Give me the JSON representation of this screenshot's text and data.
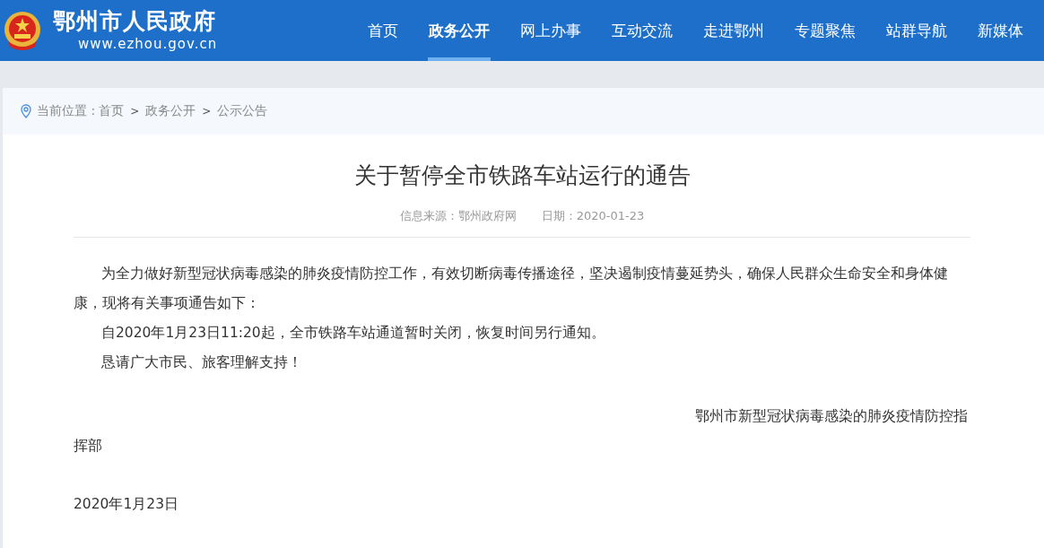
{
  "site": {
    "name": "鄂州市人民政府",
    "url": "www.ezhou.gov.cn"
  },
  "nav": [
    {
      "label": "首页",
      "selected": false
    },
    {
      "label": "政务公开",
      "selected": true
    },
    {
      "label": "网上办事",
      "selected": false
    },
    {
      "label": "互动交流",
      "selected": false
    },
    {
      "label": "走进鄂州",
      "selected": false
    },
    {
      "label": "专题聚焦",
      "selected": false
    },
    {
      "label": "站群导航",
      "selected": false
    },
    {
      "label": "新媒体",
      "selected": false
    }
  ],
  "breadcrumb": {
    "prefix": "当前位置 :",
    "items": [
      "首页",
      "政务公开",
      "公示公告"
    ],
    "separator": ">"
  },
  "article": {
    "title": "关于暂停全市铁路车站运行的通告",
    "source": "信息来源：鄂州政府网",
    "date": "日期：2020-01-23",
    "paragraphs": [
      "为全力做好新型冠状病毒感染的肺炎疫情防控工作，有效切断病毒传播途径，坚决遏制疫情蔓延势头，确保人民群众生命安全和身体健康，现将有关事项通告如下：",
      "自2020年1月23日11:20起，全市铁路车站通道暂时关闭，恢复时间另行通知。",
      "恳请广大市民、旅客理解支持！"
    ],
    "signature": "鄂州市新型冠状病毒感染的肺炎疫情防控指挥部",
    "signed_date": "2020年1月23日"
  }
}
